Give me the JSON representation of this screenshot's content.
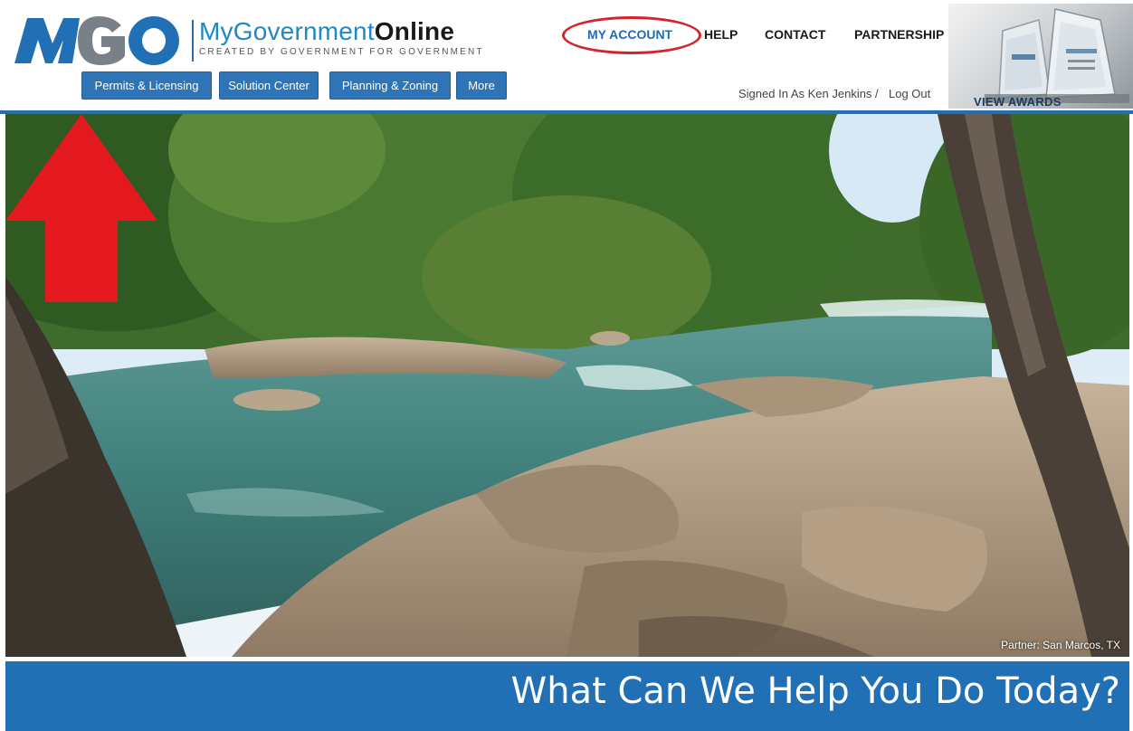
{
  "brand": {
    "name_light": "MyGovernment",
    "name_bold": "Online",
    "tagline": "CREATED BY GOVERNMENT FOR GOVERNMENT",
    "logo_letters": "MGO",
    "primary_color": "#2170b5",
    "accent_color": "#1e88c8"
  },
  "top_nav": {
    "items": [
      {
        "label": "MY ACCOUNT",
        "highlighted": true
      },
      {
        "label": "HELP"
      },
      {
        "label": "CONTACT"
      },
      {
        "label": "PARTNERSHIP"
      }
    ]
  },
  "sub_nav": {
    "buttons": [
      {
        "label": "Permits & Licensing"
      },
      {
        "label": "Solution Center"
      },
      {
        "label": "Planning & Zoning"
      },
      {
        "label": "More"
      }
    ]
  },
  "user": {
    "signed_in_text": "Signed In As Ken Jenkins /",
    "logout_label": "Log Out"
  },
  "awards": {
    "label": "VIEW AWARDS"
  },
  "hero": {
    "caption": "Partner: San Marcos, TX",
    "annotation_arrow_color": "#e3191f"
  },
  "banner": {
    "title": "What Can We Help You Do Today?"
  }
}
